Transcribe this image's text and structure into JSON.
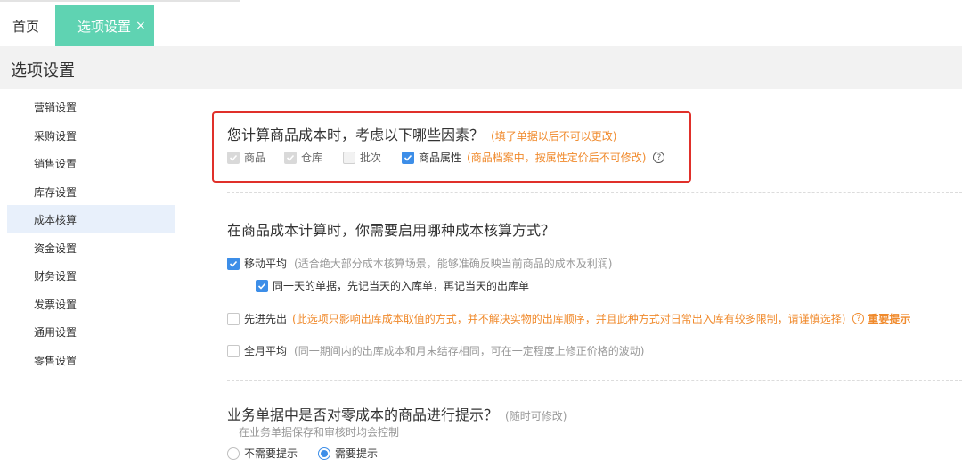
{
  "tabs": {
    "home_label": "首页",
    "active_label": "选项设置",
    "close_glyph": "×"
  },
  "page": {
    "title": "选项设置"
  },
  "sidebar": {
    "items": [
      {
        "label": "营销设置",
        "active": false
      },
      {
        "label": "采购设置",
        "active": false
      },
      {
        "label": "销售设置",
        "active": false
      },
      {
        "label": "库存设置",
        "active": false
      },
      {
        "label": "成本核算",
        "active": true
      },
      {
        "label": "资金设置",
        "active": false
      },
      {
        "label": "财务设置",
        "active": false
      },
      {
        "label": "发票设置",
        "active": false
      },
      {
        "label": "通用设置",
        "active": false
      },
      {
        "label": "零售设置",
        "active": false
      }
    ]
  },
  "section1": {
    "question": "您计算商品成本时，考虑以下哪些因素？",
    "note": "(填了单据以后不可以更改)",
    "options": [
      {
        "label": "商品",
        "state": "checked-disabled"
      },
      {
        "label": "仓库",
        "state": "checked-disabled"
      },
      {
        "label": "批次",
        "state": "disabled"
      },
      {
        "label": "商品属性",
        "state": "checked"
      }
    ],
    "attr_note": "(商品档案中，按属性定价后不可修改)",
    "help_glyph": "?"
  },
  "section2": {
    "question": "在商品成本计算时，你需要启用哪种成本核算方式？",
    "moving": {
      "label": "移动平均",
      "note": "(适合绝大部分成本核算场景，能够准确反映当前商品的成本及利润)",
      "checked": true
    },
    "same_day": {
      "label": "同一天的单据，先记当天的入库单，再记当天的出库单",
      "checked": true
    },
    "fifo": {
      "label": "先进先出",
      "note": "(此选项只影响出库成本取值的方式，并不解决实物的出库顺序，并且此种方式对日常出入库有较多限制，请谨慎选择)",
      "important": "重要提示",
      "checked": false
    },
    "monthly": {
      "label": "全月平均",
      "note": "(同一期间内的出库成本和月末结存相同，可在一定程度上修正价格的波动)",
      "checked": false
    }
  },
  "section3": {
    "question": "业务单据中是否对零成本的商品进行提示？",
    "note": "(随时可修改)",
    "sub": "在业务单据保存和审核时均会控制",
    "options": [
      {
        "label": "不需要提示",
        "checked": false
      },
      {
        "label": "需要提示",
        "checked": true
      }
    ]
  },
  "colors": {
    "accent_tab": "#5fd3b2",
    "checkbox_blue": "#3d8ee8",
    "warning_orange": "#f08a2c",
    "highlight_red": "#e0302a"
  }
}
